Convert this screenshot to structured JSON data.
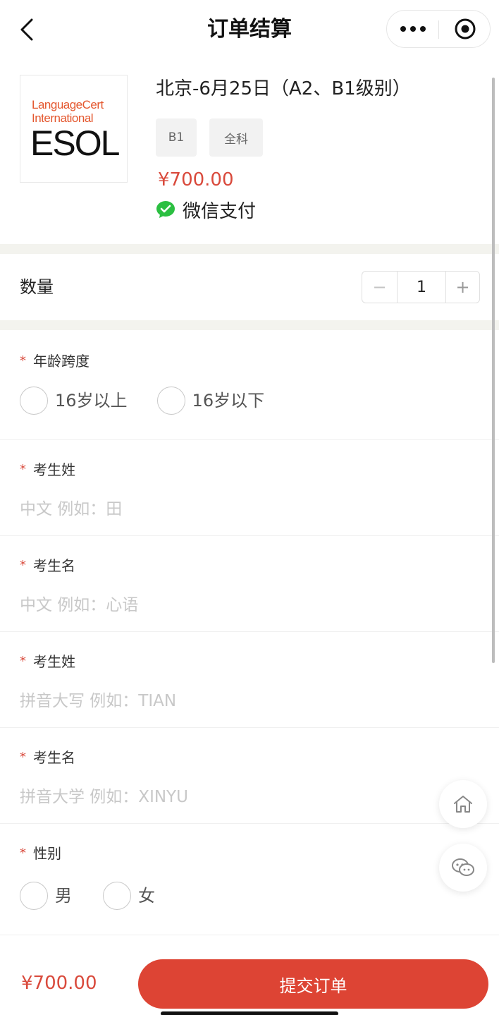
{
  "header": {
    "title": "订单结算"
  },
  "product": {
    "logo_line1": "LanguageCert",
    "logo_line2": "International",
    "logo_main": "ESOL",
    "title": "北京-6月25日（A2、B1级别）",
    "tags": [
      "B1",
      "全科"
    ],
    "price": "¥700.00",
    "payment": "微信支付"
  },
  "quantity": {
    "label": "数量",
    "minus": "−",
    "value": "1",
    "plus": "+"
  },
  "form": {
    "required_mark": "*",
    "age": {
      "label": "年龄跨度",
      "options": [
        "16岁以上",
        "16岁以下"
      ]
    },
    "surname_cn": {
      "label": "考生姓",
      "placeholder": "中文 例如：田"
    },
    "given_cn": {
      "label": "考生名",
      "placeholder": "中文 例如：心语"
    },
    "surname_py": {
      "label": "考生姓",
      "placeholder": "拼音大写 例如：TIAN"
    },
    "given_py": {
      "label": "考生名",
      "placeholder": "拼音大学 例如：XINYU"
    },
    "gender": {
      "label": "性别",
      "options": [
        "男",
        "女"
      ]
    }
  },
  "footer": {
    "total": "¥700.00",
    "submit_label": "提交订单"
  },
  "colors": {
    "accent": "#dd4434",
    "price": "#d94a3c",
    "wechat_green": "#2bbf41"
  },
  "icons": {
    "back": "chevron-left-icon",
    "more": "more-dots-icon",
    "close": "target-circle-icon",
    "home": "home-icon",
    "service": "chat-icon",
    "wechat": "wechat-pay-icon"
  }
}
